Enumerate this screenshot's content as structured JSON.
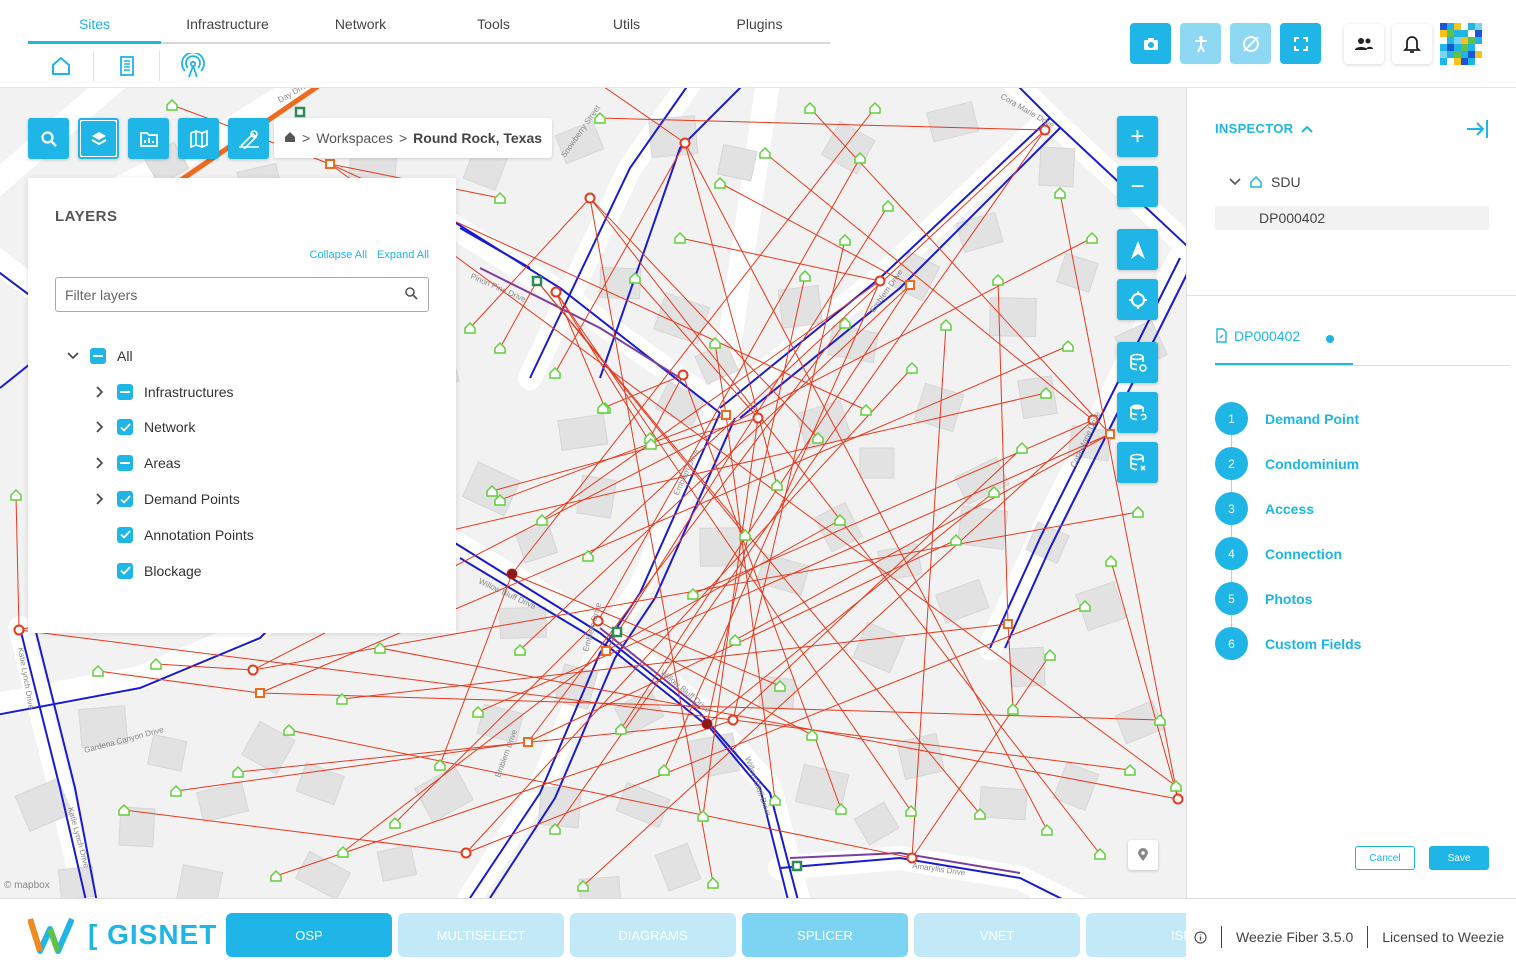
{
  "top_tabs": [
    "Sites",
    "Infrastructure",
    "Network",
    "Tools",
    "Utils",
    "Plugins"
  ],
  "active_tab": "Sites",
  "sub_icons": [
    "home-icon",
    "building-icon",
    "antenna-icon"
  ],
  "toolbar_icons": [
    "camera-icon",
    "accessibility-icon",
    "no-location-icon",
    "fullscreen-icon"
  ],
  "user_icons": [
    "users-icon",
    "bell-icon"
  ],
  "map": {
    "tools": [
      "search-icon",
      "layers-icon",
      "folder-chart-icon",
      "map-icon",
      "measure-icon"
    ],
    "breadcrumb": {
      "sep": ">",
      "workspaces": "Workspaces",
      "current": "Round Rock, Texas"
    },
    "zoom_in": "+",
    "zoom_out": "−",
    "street_labels": [
      "Pinon Pine Drive",
      "Snowberry Street",
      "Emblem Drive",
      "Willow Bluff Drive",
      "Gardena Canyon Drive",
      "Katie Lynch Drive",
      "Amaryllis Drive",
      "Cora Marie Drive",
      "Day Drive"
    ],
    "attribution": "© mapbox"
  },
  "layers": {
    "title": "LAYERS",
    "collapse_all": "Collapse All",
    "expand_all": "Expand All",
    "filter_placeholder": "Filter layers",
    "items": [
      {
        "label": "All",
        "state": "partial",
        "expandable": true,
        "expanded": true,
        "level": 0
      },
      {
        "label": "Infrastructures",
        "state": "partial",
        "expandable": true,
        "level": 1
      },
      {
        "label": "Network",
        "state": "checked",
        "expandable": true,
        "level": 1
      },
      {
        "label": "Areas",
        "state": "partial",
        "expandable": true,
        "level": 1
      },
      {
        "label": "Demand Points",
        "state": "checked",
        "expandable": true,
        "level": 1
      },
      {
        "label": "Annotation Points",
        "state": "checked",
        "expandable": false,
        "level": 1
      },
      {
        "label": "Blockage",
        "state": "checked",
        "expandable": false,
        "level": 1
      }
    ]
  },
  "inspector": {
    "title": "INSPECTOR",
    "tree_label": "SDU",
    "selected_item": "DP000402",
    "tab_label": "DP000402",
    "steps": [
      {
        "num": "1",
        "label": "Demand Point"
      },
      {
        "num": "2",
        "label": "Condominium"
      },
      {
        "num": "3",
        "label": "Access"
      },
      {
        "num": "4",
        "label": "Connection"
      },
      {
        "num": "5",
        "label": "Photos"
      },
      {
        "num": "6",
        "label": "Custom Fields"
      }
    ],
    "cancel": "Cancel",
    "save": "Save"
  },
  "bottom": {
    "brand": "[ GISNET ]",
    "modules": [
      "OSP",
      "MULTISELECT",
      "DIAGRAMS",
      "SPLICER",
      "VNET",
      "ISP"
    ],
    "version": "Weezie Fiber 3.5.0",
    "license": "Licensed to Weezie"
  },
  "colors": {
    "accent": "#1fb5e6",
    "fiber": "#1a1ad6",
    "drop": "#e8391f",
    "demand": "#5fcf3a",
    "trunk": "#7b3fa0",
    "highway": "#ef6a1f"
  }
}
